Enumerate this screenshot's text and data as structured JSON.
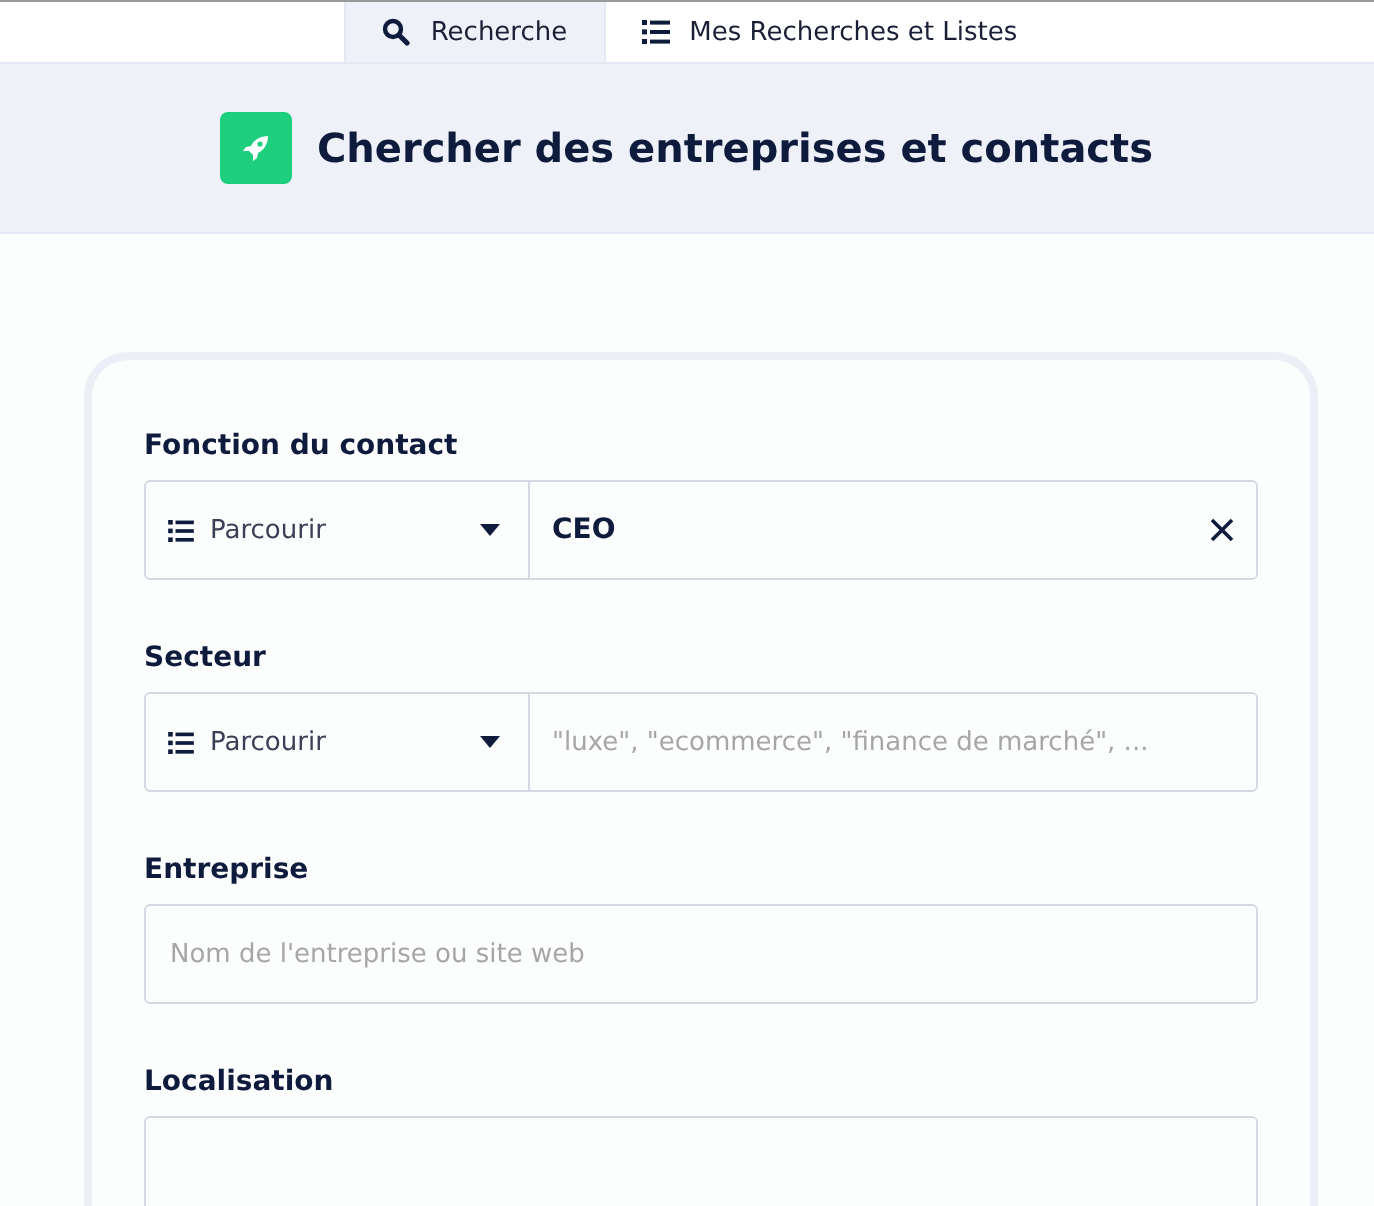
{
  "tabs": [
    {
      "label": "Recherche",
      "kind": "search",
      "selected": true
    },
    {
      "label": "Mes Recherches et Listes",
      "kind": "list",
      "selected": false
    }
  ],
  "header": {
    "title": "Chercher des entreprises et contacts"
  },
  "fields": [
    {
      "kind": "browse",
      "label": "Fonction du contact",
      "select": "Parcourir",
      "value": "CEO",
      "clearable": true
    },
    {
      "kind": "browse",
      "label": "Secteur",
      "select": "Parcourir",
      "placeholder": "\"luxe\", \"ecommerce\", \"finance de marché\", ..."
    },
    {
      "kind": "text",
      "label": "Entreprise",
      "placeholder": "Nom de l'entreprise ou site web"
    },
    {
      "kind": "text",
      "label": "Localisation"
    }
  ]
}
